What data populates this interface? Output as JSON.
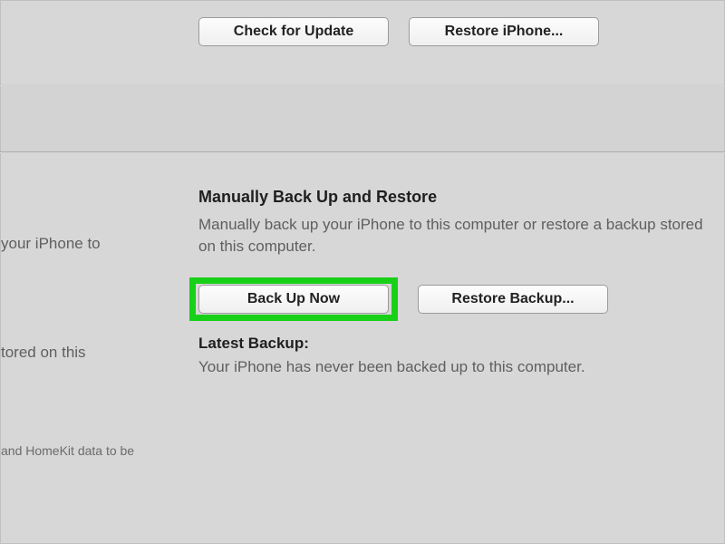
{
  "top": {
    "check_update_label": "Check for Update",
    "restore_iphone_label": "Restore iPhone..."
  },
  "left_fragments": {
    "frag1": "your iPhone to",
    "frag2": "tored on this",
    "frag3": "and HomeKit data to be"
  },
  "manual": {
    "heading": "Manually Back Up and Restore",
    "description": "Manually back up your iPhone to this computer or restore a backup stored on this computer.",
    "back_up_now_label": "Back Up Now",
    "restore_backup_label": "Restore Backup..."
  },
  "latest": {
    "heading": "Latest Backup:",
    "status": "Your iPhone has never been backed up to this computer."
  }
}
